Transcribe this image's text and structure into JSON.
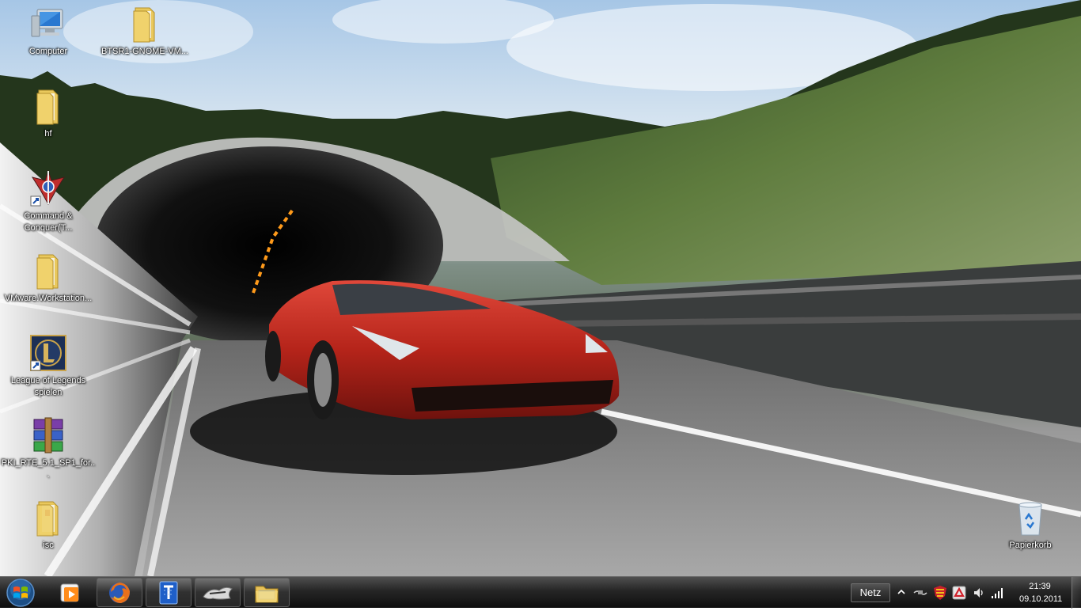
{
  "desktop": {
    "icons": [
      {
        "label": "Computer",
        "icon": "computer-icon"
      },
      {
        "label": "BTSR1-GNOME-VM...",
        "icon": "folder-icon"
      },
      {
        "label": "hf",
        "icon": "folder-icon"
      },
      {
        "label": "Command & Conquer(T...",
        "icon": "command-and-conquer-shortcut-icon"
      },
      {
        "label": "VMware.Workstation...",
        "icon": "folder-icon"
      },
      {
        "label": "League of Legends spielen",
        "icon": "league-of-legends-shortcut-icon"
      },
      {
        "label": "PKI_RTE_5.1_SP1_for...",
        "icon": "winrar-archive-icon"
      },
      {
        "label": "isc",
        "icon": "folder-icon"
      },
      {
        "label": "Papierkorb",
        "icon": "recycle-bin-icon"
      }
    ]
  },
  "taskbar": {
    "start_icon": "windows-start-orb-icon",
    "items": [
      {
        "icon": "media-player-icon",
        "running": false
      },
      {
        "icon": "firefox-icon",
        "running": true
      },
      {
        "icon": "blue-app-icon",
        "running": true
      },
      {
        "icon": "game-launcher-icon",
        "running": true
      },
      {
        "icon": "file-explorer-icon",
        "running": true
      }
    ],
    "toolbar_label": "Netz",
    "tray_icons": [
      "show-hidden-icons-chevron-icon",
      "network-device-icon",
      "shield-app-icon",
      "red-app-icon",
      "volume-icon",
      "signal-strength-icon"
    ],
    "clock": {
      "time": "21:39",
      "date": "09.10.2011"
    }
  },
  "colors": {
    "taskbar": "#1a1a1a",
    "car_red": "#c8281c",
    "sky": "#b7d1ea",
    "label_text": "#ffffff"
  }
}
